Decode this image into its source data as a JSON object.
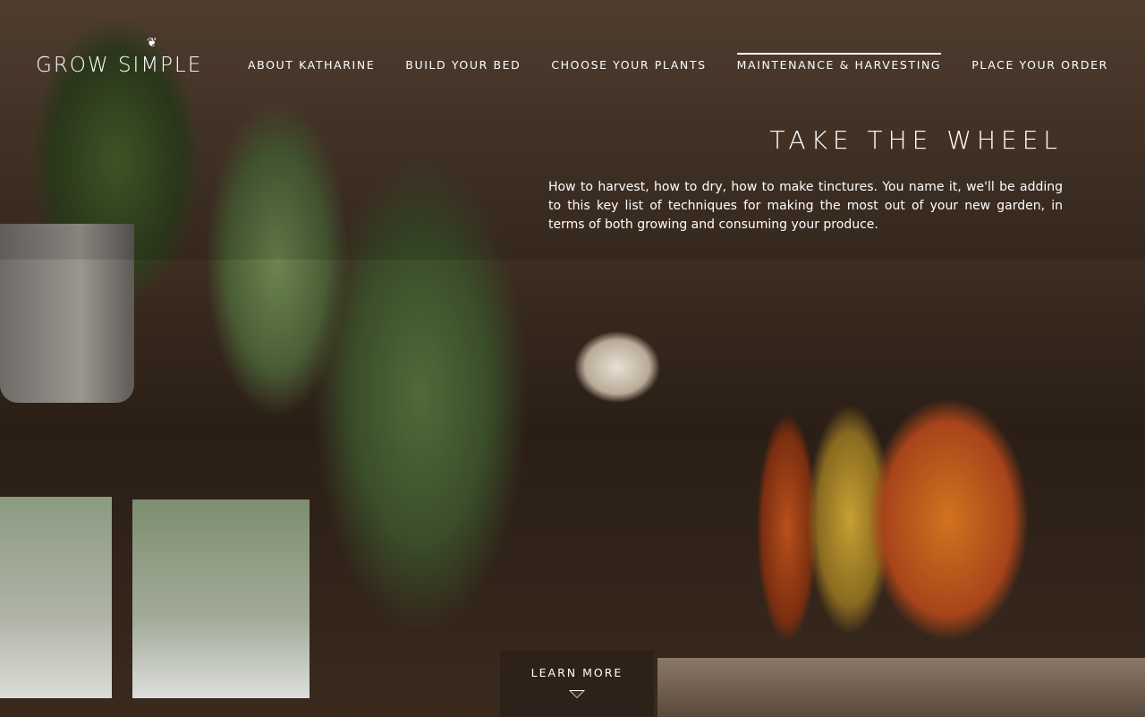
{
  "brand": {
    "name": "GROW SIMPLE",
    "leaf_icon": "leaf-icon"
  },
  "nav": {
    "items": [
      {
        "label": "ABOUT KATHARINE",
        "active": false
      },
      {
        "label": "BUILD YOUR BED",
        "active": false
      },
      {
        "label": "CHOOSE YOUR PLANTS",
        "active": false
      },
      {
        "label": "MAINTENANCE & HARVESTING",
        "active": true
      },
      {
        "label": "PLACE YOUR ORDER",
        "active": false
      }
    ]
  },
  "hero": {
    "title": "TAKE THE WHEEL",
    "text": "How to harvest, how to dry, how to make tinctures. You name it, we'll be adding to this key list of techniques for making the most out of your new garden, in terms of both growing and consuming your produce."
  },
  "learn_more": {
    "label": "LEARN MORE",
    "icon": "triangle-down-icon"
  }
}
